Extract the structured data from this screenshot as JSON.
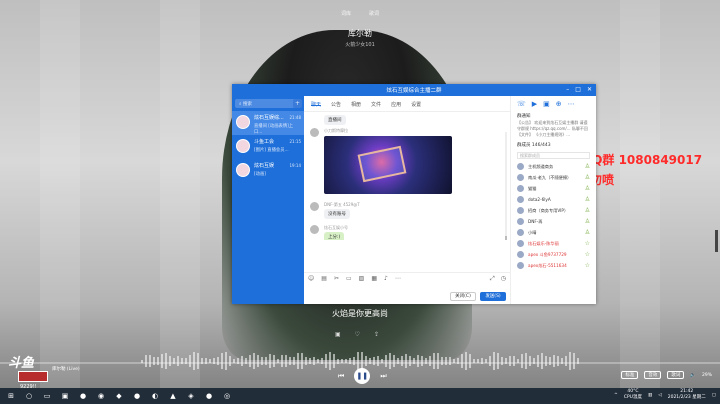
{
  "music": {
    "tabs": [
      "词库",
      "歌词"
    ],
    "song_title": "库尔勒",
    "song_artist": "火箭少女101",
    "lyric": "火焰是你更高尚",
    "now_playing": "库尔勒 (Live)",
    "time": "9229!!",
    "progress": 0.0,
    "right_pills": [
      "标准",
      "音效",
      "歌词"
    ],
    "volume": "29%"
  },
  "overlay": {
    "line1": "开黑QQ群 1080849017",
    "line2": "大佬勿喷"
  },
  "qq": {
    "window_title": "炫石互娱综合主播二群",
    "search_placeholder": "搜索",
    "conversations": [
      {
        "name": "炫石互娱综...",
        "msg": "直播间 [动画表情]上口...",
        "time": "21:48"
      },
      {
        "name": "斗鱼工会",
        "msg": "[图片] 直播会员...",
        "time": "21:15"
      },
      {
        "name": "炫石互娱",
        "msg": "[动画]",
        "time": "19:14"
      }
    ],
    "tabs": [
      "聊天",
      "公告",
      "相册",
      "文件",
      "应用",
      "设置"
    ],
    "chat": {
      "bubble1": "直播间",
      "sender1": "小刀斯特摩拉",
      "sender2": "DNF-第五 4529@T",
      "bubble2": "没有账号",
      "sender3": "炫石互娱小号",
      "bubble3": "上分:)"
    },
    "btn_close": "关闭(C)",
    "btn_send": "发送(S)",
    "right": {
      "notice_title": "群通知",
      "notice_body": "【公告】 欢迎来到炫石互娱主播群 请遵守群规 https://qz.qq.com/... 私聊不回 【文件】 《小刀主播规则》...",
      "member_count": "群成员 146/443",
      "search_members": "搜索群成员",
      "members": [
        {
          "name": "主机频道商务",
          "red": false
        },
        {
          "name": "南瓜·老九（不随便撩）",
          "red": false
        },
        {
          "name": "猫猫",
          "red": false
        },
        {
          "name": "dota2-6lyA",
          "red": false
        },
        {
          "name": "招商（商务专用VIP）",
          "red": false
        },
        {
          "name": "DNF-再",
          "red": false
        },
        {
          "name": "小晴",
          "red": false
        },
        {
          "name": "炫石娱乐-陈华丽",
          "red": true
        },
        {
          "name": "apex 斗鱼9737729",
          "red": true
        },
        {
          "name": "apex炫石-5511634",
          "red": true
        }
      ]
    }
  },
  "taskbar": {
    "cpu": "40°C",
    "cpu_label": "CPU温度",
    "time": "21:42",
    "date": "2021/2/23 星期二"
  }
}
